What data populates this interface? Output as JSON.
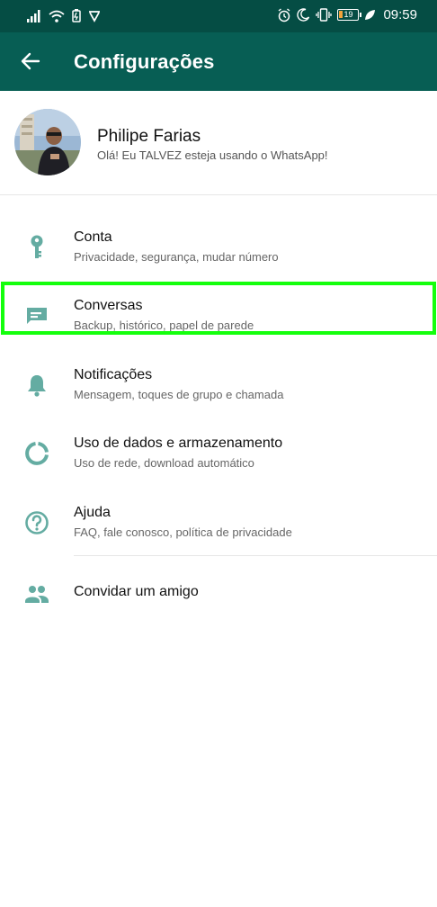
{
  "status_bar": {
    "battery_level": "19",
    "time": "09:59"
  },
  "header": {
    "title": "Configurações"
  },
  "profile": {
    "name": "Philipe Farias",
    "status": "Olá! Eu TALVEZ esteja usando o WhatsApp!"
  },
  "settings": [
    {
      "icon": "key-icon",
      "title": "Conta",
      "subtitle": "Privacidade, segurança, mudar número"
    },
    {
      "icon": "chat-icon",
      "title": "Conversas",
      "subtitle": "Backup, histórico, papel de parede"
    },
    {
      "icon": "bell-icon",
      "title": "Notificações",
      "subtitle": "Mensagem, toques de grupo e chamada"
    },
    {
      "icon": "data-usage-icon",
      "title": "Uso de dados e armazenamento",
      "subtitle": "Uso de rede, download automático"
    },
    {
      "icon": "help-icon",
      "title": "Ajuda",
      "subtitle": "FAQ, fale conosco, política de privacidade"
    }
  ],
  "invite": {
    "icon": "people-icon",
    "title": "Convidar um amigo"
  },
  "colors": {
    "statusbar": "#054d44",
    "appbar": "#075e54",
    "icon": "#64aca2",
    "highlight": "#14ff0c"
  }
}
